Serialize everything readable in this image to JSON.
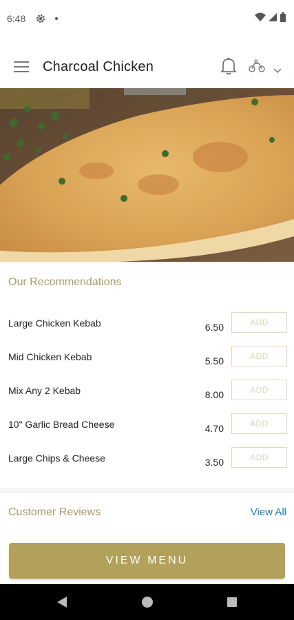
{
  "status_bar": {
    "time": "6:48"
  },
  "app_bar": {
    "title": "Charcoal Chicken"
  },
  "recommendations": {
    "title": "Our Recommendations",
    "add_label": "ADD",
    "items": [
      {
        "name": "Large Chicken Kebab",
        "price": "6.50"
      },
      {
        "name": "Mid Chicken Kebab",
        "price": "5.50"
      },
      {
        "name": "Mix Any 2 Kebab",
        "price": "8.00"
      },
      {
        "name": "10\" Garlic Bread Cheese",
        "price": "4.70"
      },
      {
        "name": "Large Chips & Cheese",
        "price": "3.50"
      }
    ]
  },
  "reviews": {
    "title": "Customer Reviews",
    "view_all": "View All"
  },
  "cta": {
    "label": "VIEW MENU"
  },
  "colors": {
    "accent": "#b2a15a",
    "accent_text": "#a99a6c",
    "link": "#1f7ab5"
  }
}
